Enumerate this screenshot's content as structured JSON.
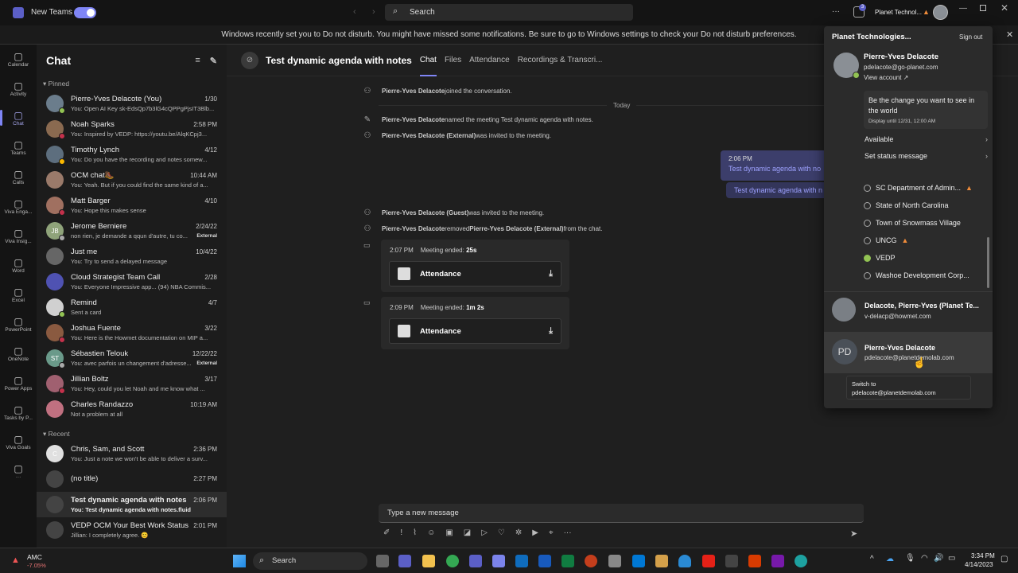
{
  "titlebar": {
    "new_teams_label": "New Teams",
    "search_placeholder": "Search",
    "org_label": "Planet Technol...",
    "badge_count": "3",
    "more": "···"
  },
  "banner": {
    "text": "Windows recently set you to Do not disturb. You might have missed some notifications. Be sure to go to Windows settings to check your Do not disturb preferences."
  },
  "rail": [
    {
      "label": "Calendar",
      "icon": "calendar-icon"
    },
    {
      "label": "Activity",
      "icon": "bell-icon"
    },
    {
      "label": "Chat",
      "icon": "chat-icon",
      "active": true
    },
    {
      "label": "Teams",
      "icon": "teams-icon"
    },
    {
      "label": "Calls",
      "icon": "phone-icon"
    },
    {
      "label": "Viva Enga...",
      "icon": "viva-engage-icon"
    },
    {
      "label": "Viva Insig...",
      "icon": "viva-insights-icon"
    },
    {
      "label": "Word",
      "icon": "word-icon"
    },
    {
      "label": "Excel",
      "icon": "excel-icon"
    },
    {
      "label": "PowerPoint",
      "icon": "powerpoint-icon"
    },
    {
      "label": "OneNote",
      "icon": "onenote-icon"
    },
    {
      "label": "Power Apps",
      "icon": "power-apps-icon"
    },
    {
      "label": "Tasks by P...",
      "icon": "tasks-icon"
    },
    {
      "label": "Viva Goals",
      "icon": "viva-goals-icon"
    },
    {
      "label": "···",
      "icon": "more-icon"
    }
  ],
  "chatlist": {
    "title": "Chat",
    "pinned_label": "Pinned",
    "recent_label": "Recent",
    "pinned": [
      {
        "name": "Pierre-Yves Delacote (You)",
        "time": "1/30",
        "preview": "You: Open AI Key sk-EdsQp7b3lG4cQPPgPjsIT3Blb...",
        "color": "#6b7d8c",
        "status": "#92c353"
      },
      {
        "name": "Noah Sparks",
        "time": "2:58 PM",
        "preview": "You: Inspired by VEDP: https://youtu.be/AlqKCpj3...",
        "color": "#8a6a50",
        "status": "#c4314b"
      },
      {
        "name": "Timothy Lynch",
        "time": "4/12",
        "preview": "You: Do you have the recording and notes somew...",
        "color": "#5d6e7e",
        "status": "#fcb900"
      },
      {
        "name": "OCM chat🥾",
        "time": "10:44 AM",
        "preview": "You: Yeah. But if you could find the same kind of a...",
        "color": "#9a7a6a",
        "status": ""
      },
      {
        "name": "Matt Barger",
        "time": "4/10",
        "preview": "You: Hope this makes sense",
        "color": "#a07060",
        "status": "#c4314b"
      },
      {
        "name": "Jerome Berniere",
        "time": "2/24/22",
        "preview": "non rien, je demande a qqun d'autre, tu co...",
        "ext": "External",
        "color": "#8fa37a",
        "initials": "JB",
        "status": "#aaa"
      },
      {
        "name": "Just me",
        "time": "10/4/22",
        "preview": "You: Try to send a delayed message",
        "color": "#666",
        "status": ""
      },
      {
        "name": "Cloud Strategist Team Call",
        "time": "2/28",
        "preview": "You: Everyone Impressive app... (94) NBA Commis...",
        "color": "#4f52b2",
        "status": ""
      },
      {
        "name": "Remind",
        "time": "4/7",
        "preview": "Sent a card",
        "color": "#d0d0d0",
        "status": "#92c353"
      },
      {
        "name": "Joshua Fuente",
        "time": "3/22",
        "preview": "You: Here is the Howmet documentation on MIP a...",
        "color": "#8a5a40",
        "status": "#c4314b"
      },
      {
        "name": "Sébastien Telouk",
        "time": "12/22/22",
        "preview": "You: avec parfois un changement d'adresse...",
        "ext": "External",
        "color": "#6a9a8a",
        "initials": "ST",
        "status": "#aaa"
      },
      {
        "name": "Jillian Boltz",
        "time": "3/17",
        "preview": "You: Hey, could you let Noah and me know what ...",
        "color": "#a06070",
        "status": "#c4314b"
      },
      {
        "name": "Charles Randazzo",
        "time": "10:19 AM",
        "preview": "Not a problem at all",
        "color": "#c07080",
        "status": ""
      }
    ],
    "recent": [
      {
        "name": "Chris, Sam, and Scott",
        "time": "2:36 PM",
        "preview": "You: Just a note we won't be able to deliver a surv...",
        "color": "#e0e0e0",
        "initials": "C",
        "status": ""
      },
      {
        "name": "(no title)",
        "time": "2:27 PM",
        "preview": "",
        "color": "#444",
        "status": ""
      },
      {
        "name": "Test dynamic agenda with notes",
        "time": "2:06 PM",
        "preview": "You: Test dynamic agenda with notes.fluid",
        "color": "#444",
        "status": "",
        "selected": true
      },
      {
        "name": "VEDP OCM Your Best Work Status",
        "time": "2:01 PM",
        "preview": "Jillian: I completely agree. 😊",
        "color": "#444",
        "status": ""
      }
    ]
  },
  "meeting": {
    "title": "Test dynamic agenda with notes",
    "tabs": [
      "Chat",
      "Files",
      "Attendance",
      "Recordings & Transcri..."
    ]
  },
  "messages": {
    "joined": [
      "Pierre-Yves Delacote",
      " joined the conversation."
    ],
    "today": "Today",
    "named": [
      "Pierre-Yves Delacote",
      " named the meeting Test dynamic agenda with notes."
    ],
    "invited_ext": [
      "Pierre-Yves Delacote (External)",
      " was invited to the meeting."
    ],
    "bubble_time": "2:06 PM",
    "bubble_text": "Test dynamic agenda with no",
    "bubble_link": "Test dynamic agenda with n",
    "invited_guest": [
      "Pierre-Yves Delacote (Guest)",
      " was invited to the meeting."
    ],
    "removed": [
      "Pierre-Yves Delacote",
      " removed ",
      "Pierre-Yves Delacote (External)",
      " from the chat."
    ],
    "meeting1": {
      "time": "2:07 PM",
      "label": "Meeting ended: ",
      "duration": "25s",
      "attendance": "Attendance"
    },
    "meeting2": {
      "time": "2:09 PM",
      "label": "Meeting ended: ",
      "duration": "1m 2s",
      "attendance": "Attendance"
    }
  },
  "composer": {
    "placeholder": "Type a new message"
  },
  "account": {
    "org": "Planet Technologies...",
    "sign_out": "Sign out",
    "name": "Pierre-Yves Delacote",
    "email": "pdelacote@go-planet.com",
    "view_account": "View account ↗",
    "status_message": "Be the change you want to see in the world",
    "display_until": "Display until 12/31, 12:00 AM",
    "available": "Available",
    "set_status": "Set status message",
    "orgs": [
      {
        "name": "SC Department of Admin...",
        "warn": true,
        "ok": false
      },
      {
        "name": "State of North Carolina",
        "warn": false,
        "ok": false
      },
      {
        "name": "Town of Snowmass Village",
        "warn": false,
        "ok": false
      },
      {
        "name": "UNCG",
        "warn": true,
        "ok": false
      },
      {
        "name": "VEDP",
        "warn": false,
        "ok": true
      },
      {
        "name": "Washoe Development Corp...",
        "warn": false,
        "ok": false
      }
    ],
    "other1": {
      "name": "Delacote, Pierre-Yves (Planet Te...",
      "email": "v-delacp@howmet.com"
    },
    "other2": {
      "name": "Pierre-Yves Delacote",
      "email": "pdelacote@planetdemolab.com",
      "initials": "PD"
    },
    "tooltip": [
      "Switch to",
      "pdelacote@planetdemolab.com"
    ]
  },
  "taskbar": {
    "stock_name": "AMC",
    "stock_change": "-7.05%",
    "search": "Search",
    "time": "3:34 PM",
    "date": "4/14/2023"
  }
}
